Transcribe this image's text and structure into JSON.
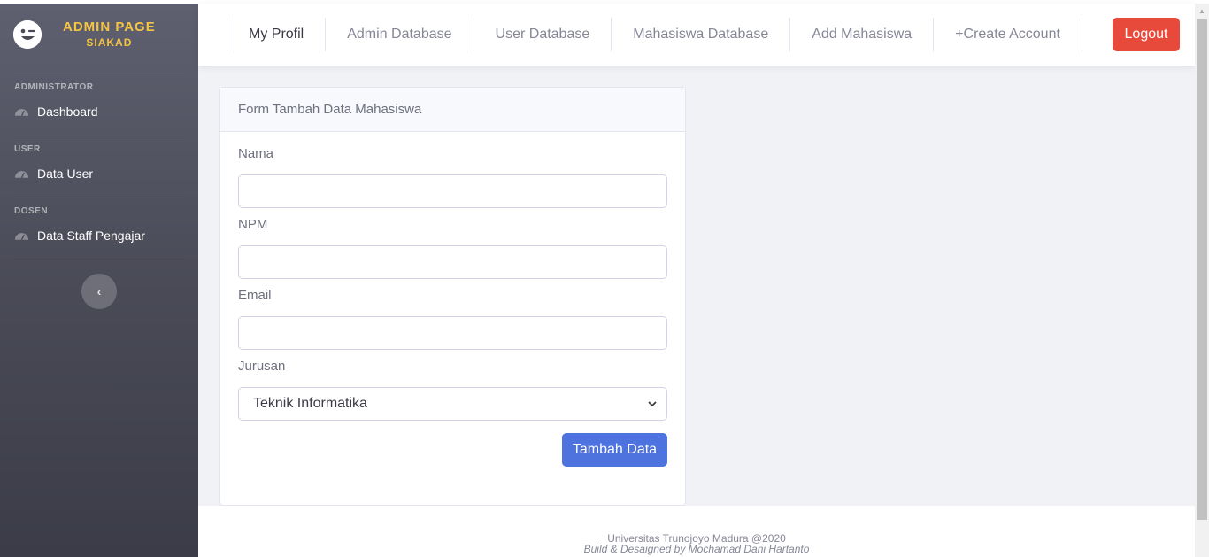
{
  "sidebar": {
    "brand_title": "ADMIN PAGE",
    "brand_sub": "SIAKAD",
    "brand_icon": "wink-face-icon",
    "sections": [
      {
        "heading": "ADMINISTRATOR",
        "item": "Dashboard"
      },
      {
        "heading": "USER",
        "item": "Data User"
      },
      {
        "heading": "DOSEN",
        "item": "Data Staff Pengajar"
      }
    ],
    "item_icon": "tachometer-icon",
    "toggle_glyph": "‹"
  },
  "topbar": {
    "nav": [
      "My Profil",
      "Admin Database",
      "User Database",
      "Mahasiswa Database",
      "Add Mahasiswa",
      "+Create Account"
    ],
    "logout_label": "Logout"
  },
  "form": {
    "title": "Form Tambah Data Mahasiswa",
    "fields": [
      {
        "label": "Nama",
        "value": ""
      },
      {
        "label": "NPM",
        "value": ""
      },
      {
        "label": "Email",
        "value": ""
      }
    ],
    "jurusan_label": "Jurusan",
    "jurusan_selected": "Teknik Informatika",
    "submit_label": "Tambah Data"
  },
  "footer": {
    "line1": "Universitas Trunojoyo Madura @2020",
    "line2": "Build & Desaigned by Mochamad Dani Hartanto"
  },
  "colors": {
    "brand_yellow": "#f5c542",
    "logout_red": "#e74a3b",
    "primary_blue": "#4e73df"
  }
}
